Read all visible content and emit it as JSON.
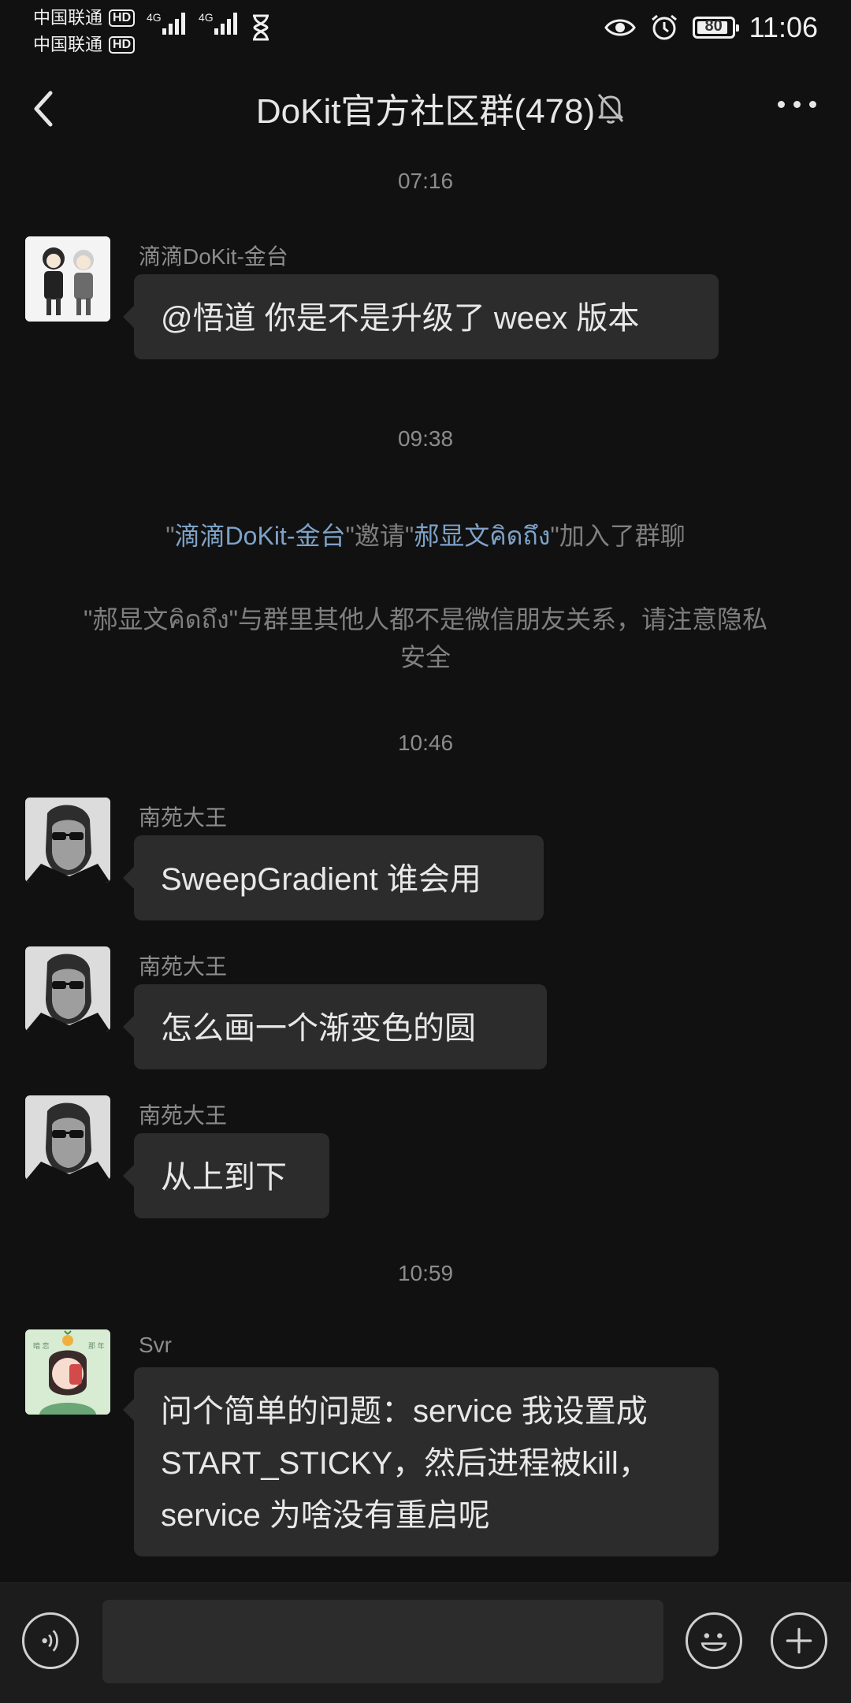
{
  "status_bar": {
    "carrier_1": "中国联通",
    "carrier_2": "中国联通",
    "hd_label": "HD",
    "network_1": "4G",
    "network_2": "4G",
    "battery": "80",
    "time": "11:06"
  },
  "nav": {
    "title": "DoKit官方社区群(478)"
  },
  "messages": {
    "t1": "07:16",
    "m1_sender": "滴滴DoKit-金台",
    "m1_text": "@悟道  你是不是升级了 weex 版本",
    "t2": "09:38",
    "sys1_q1": "\"",
    "sys1_inviter": "滴滴DoKit-金台",
    "sys1_mid": "\"邀请\"",
    "sys1_invitee": "郝显文คิดถึง",
    "sys1_end": "\"加入了群聊",
    "sys2": "\"郝显文คิดถึง\"与群里其他人都不是微信朋友关系，请注意隐私安全",
    "t3": "10:46",
    "m2_sender": "南苑大王",
    "m2_text": "SweepGradient 谁会用",
    "m3_sender": "南苑大王",
    "m3_text": "怎么画一个渐变色的圆",
    "m4_sender": "南苑大王",
    "m4_text": "从上到下",
    "t4": "10:59",
    "m5_sender": "Svr",
    "m5_text": "问个简单的问题：service 我设置成 START_STICKY，然后进程被kill，service 为啥没有重启呢"
  },
  "colors": {
    "background": "#111111",
    "bubble": "#2c2c2c",
    "link": "#7ea2c8"
  },
  "icons": [
    "back-arrow-icon",
    "mute-bell-icon",
    "more-dots-icon",
    "voice-icon",
    "emoji-icon",
    "plus-icon"
  ]
}
